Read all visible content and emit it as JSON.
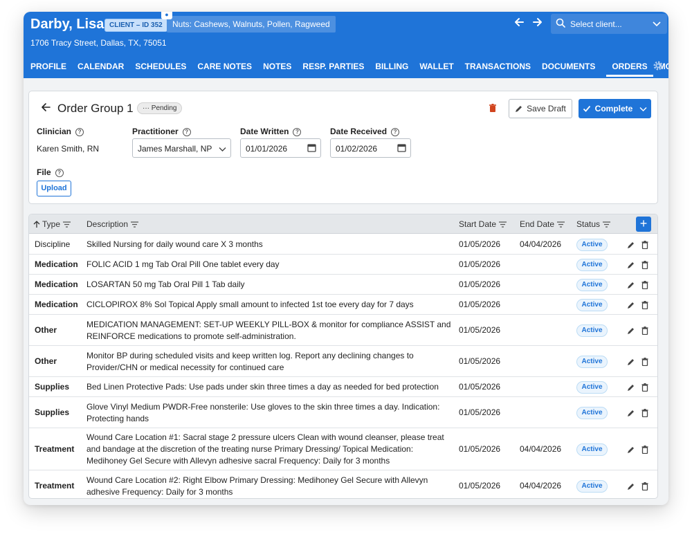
{
  "header": {
    "client_name": "Darby, Lisa",
    "client_badge": "CLIENT – ID 352",
    "allergies": "Nuts: Cashews, Walnuts, Pollen, Ragweed",
    "address": "1706 Tracy Street, Dallas, TX, 75051",
    "select_placeholder": "Select client..."
  },
  "tabs": [
    {
      "label": "PROFILE",
      "active": false
    },
    {
      "label": "CALENDAR",
      "active": false
    },
    {
      "label": "SCHEDULES",
      "active": false
    },
    {
      "label": "CARE NOTES",
      "active": false
    },
    {
      "label": "NOTES",
      "active": false
    },
    {
      "label": "RESP. PARTIES",
      "active": false
    },
    {
      "label": "BILLING",
      "active": false
    },
    {
      "label": "WALLET",
      "active": false
    },
    {
      "label": "TRANSACTIONS",
      "active": false
    },
    {
      "label": "DOCUMENTS",
      "active": false
    },
    {
      "label": "ORDERS",
      "active": true
    },
    {
      "label": "MORE",
      "active": false
    }
  ],
  "order": {
    "title": "Order Group 1",
    "status": "··· Pending",
    "save_draft": "Save Draft",
    "complete": "Complete",
    "clinician_label": "Clinician",
    "clinician_value": "Karen Smith, RN",
    "practitioner_label": "Practitioner",
    "practitioner_value": "James Marshall, NP",
    "date_written_label": "Date Written",
    "date_written_value": "01/01/2026",
    "date_received_label": "Date Received",
    "date_received_value": "01/02/2026",
    "file_label": "File",
    "upload": "Upload"
  },
  "table": {
    "headers": {
      "type": "Type",
      "description": "Description",
      "start": "Start Date",
      "end": "End Date",
      "status": "Status"
    },
    "rows": [
      {
        "type": "Discipline",
        "bold": false,
        "description": "Skilled Nursing for daily wound care X 3 months",
        "start": "01/05/2026",
        "end": "04/04/2026",
        "status": "Active"
      },
      {
        "type": "Medication",
        "bold": true,
        "description": "FOLIC ACID 1 mg Tab Oral Pill  One tablet every day",
        "start": "01/05/2026",
        "end": "",
        "status": "Active"
      },
      {
        "type": "Medication",
        "bold": true,
        "description": "LOSARTAN 50 mg Tab Oral Pill  1 Tab daily",
        "start": "01/05/2026",
        "end": "",
        "status": "Active"
      },
      {
        "type": "Medication",
        "bold": true,
        "description": "CICLOPIROX 8% Sol Topical  Apply small amount to infected 1st toe every day for 7 days",
        "start": "01/05/2026",
        "end": "",
        "status": "Active"
      },
      {
        "type": "Other",
        "bold": true,
        "description": "MEDICATION MANAGEMENT: SET-UP WEEKLY PILL-BOX & monitor for compliance ASSIST and REINFORCE medications to promote self-administration.",
        "start": "01/05/2026",
        "end": "",
        "status": "Active"
      },
      {
        "type": "Other",
        "bold": true,
        "description": "Monitor BP during scheduled visits and keep written log. Report any declining changes to Provider/CHN or medical necessity for continued care",
        "start": "01/05/2026",
        "end": "",
        "status": "Active"
      },
      {
        "type": "Supplies",
        "bold": true,
        "description": "Bed Linen Protective Pads: Use pads under skin three times a day as needed for bed protection",
        "start": "01/05/2026",
        "end": "",
        "status": "Active"
      },
      {
        "type": "Supplies",
        "bold": true,
        "description": "Glove Vinyl Medium PWDR-Free nonsterile: Use gloves to the skin three times a day. Indication: Protecting hands",
        "start": "01/05/2026",
        "end": "",
        "status": "Active"
      },
      {
        "type": "Treatment",
        "bold": true,
        "description": "Wound Care Location #1: Sacral stage 2 pressure ulcers Clean with wound cleanser, please treat and bandage at the discretion of the treating nurse Primary Dressing/ Topical Medication: Medihoney Gel Secure with Allevyn adhesive sacral Frequency: Daily for 3 months",
        "start": "01/05/2026",
        "end": "04/04/2026",
        "status": "Active"
      },
      {
        "type": "Treatment",
        "bold": true,
        "description": "Wound Care Location #2: Right Elbow Primary Dressing: Medihoney Gel Secure with Allevyn adhesive Frequency: Daily for 3 months",
        "start": "01/05/2026",
        "end": "04/04/2026",
        "status": "Active"
      }
    ]
  }
}
